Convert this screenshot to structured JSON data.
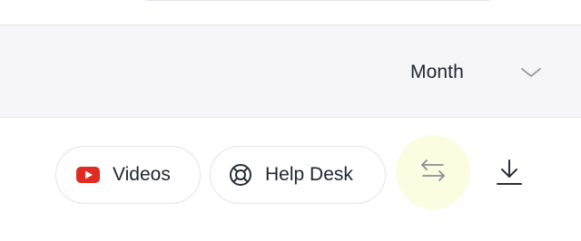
{
  "filter_bar": {
    "period_value": "Month"
  },
  "toolbar": {
    "videos_label": "Videos",
    "helpdesk_label": "Help Desk"
  },
  "icons": {
    "videos": "youtube-play-icon",
    "helpdesk": "lifebuoy-icon",
    "swap": "swap-arrows-icon",
    "download": "download-icon",
    "period_chevron": "chevron-down-icon"
  },
  "colors": {
    "youtube_red": "#e02b20",
    "swap_highlight": "#fbfde0",
    "icon_gray": "#8a8d96"
  }
}
